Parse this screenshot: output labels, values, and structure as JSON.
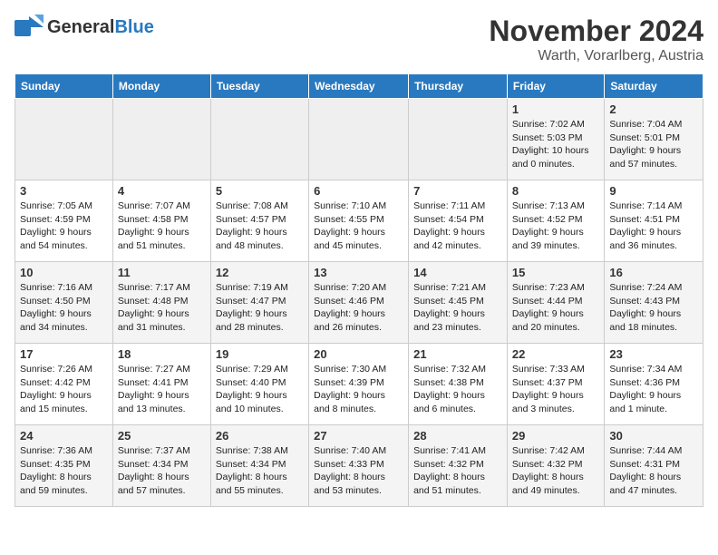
{
  "header": {
    "logo_general": "General",
    "logo_blue": "Blue",
    "month": "November 2024",
    "location": "Warth, Vorarlberg, Austria"
  },
  "weekdays": [
    "Sunday",
    "Monday",
    "Tuesday",
    "Wednesday",
    "Thursday",
    "Friday",
    "Saturday"
  ],
  "weeks": [
    [
      {
        "day": "",
        "info": ""
      },
      {
        "day": "",
        "info": ""
      },
      {
        "day": "",
        "info": ""
      },
      {
        "day": "",
        "info": ""
      },
      {
        "day": "",
        "info": ""
      },
      {
        "day": "1",
        "info": "Sunrise: 7:02 AM\nSunset: 5:03 PM\nDaylight: 10 hours\nand 0 minutes."
      },
      {
        "day": "2",
        "info": "Sunrise: 7:04 AM\nSunset: 5:01 PM\nDaylight: 9 hours\nand 57 minutes."
      }
    ],
    [
      {
        "day": "3",
        "info": "Sunrise: 7:05 AM\nSunset: 4:59 PM\nDaylight: 9 hours\nand 54 minutes."
      },
      {
        "day": "4",
        "info": "Sunrise: 7:07 AM\nSunset: 4:58 PM\nDaylight: 9 hours\nand 51 minutes."
      },
      {
        "day": "5",
        "info": "Sunrise: 7:08 AM\nSunset: 4:57 PM\nDaylight: 9 hours\nand 48 minutes."
      },
      {
        "day": "6",
        "info": "Sunrise: 7:10 AM\nSunset: 4:55 PM\nDaylight: 9 hours\nand 45 minutes."
      },
      {
        "day": "7",
        "info": "Sunrise: 7:11 AM\nSunset: 4:54 PM\nDaylight: 9 hours\nand 42 minutes."
      },
      {
        "day": "8",
        "info": "Sunrise: 7:13 AM\nSunset: 4:52 PM\nDaylight: 9 hours\nand 39 minutes."
      },
      {
        "day": "9",
        "info": "Sunrise: 7:14 AM\nSunset: 4:51 PM\nDaylight: 9 hours\nand 36 minutes."
      }
    ],
    [
      {
        "day": "10",
        "info": "Sunrise: 7:16 AM\nSunset: 4:50 PM\nDaylight: 9 hours\nand 34 minutes."
      },
      {
        "day": "11",
        "info": "Sunrise: 7:17 AM\nSunset: 4:48 PM\nDaylight: 9 hours\nand 31 minutes."
      },
      {
        "day": "12",
        "info": "Sunrise: 7:19 AM\nSunset: 4:47 PM\nDaylight: 9 hours\nand 28 minutes."
      },
      {
        "day": "13",
        "info": "Sunrise: 7:20 AM\nSunset: 4:46 PM\nDaylight: 9 hours\nand 26 minutes."
      },
      {
        "day": "14",
        "info": "Sunrise: 7:21 AM\nSunset: 4:45 PM\nDaylight: 9 hours\nand 23 minutes."
      },
      {
        "day": "15",
        "info": "Sunrise: 7:23 AM\nSunset: 4:44 PM\nDaylight: 9 hours\nand 20 minutes."
      },
      {
        "day": "16",
        "info": "Sunrise: 7:24 AM\nSunset: 4:43 PM\nDaylight: 9 hours\nand 18 minutes."
      }
    ],
    [
      {
        "day": "17",
        "info": "Sunrise: 7:26 AM\nSunset: 4:42 PM\nDaylight: 9 hours\nand 15 minutes."
      },
      {
        "day": "18",
        "info": "Sunrise: 7:27 AM\nSunset: 4:41 PM\nDaylight: 9 hours\nand 13 minutes."
      },
      {
        "day": "19",
        "info": "Sunrise: 7:29 AM\nSunset: 4:40 PM\nDaylight: 9 hours\nand 10 minutes."
      },
      {
        "day": "20",
        "info": "Sunrise: 7:30 AM\nSunset: 4:39 PM\nDaylight: 9 hours\nand 8 minutes."
      },
      {
        "day": "21",
        "info": "Sunrise: 7:32 AM\nSunset: 4:38 PM\nDaylight: 9 hours\nand 6 minutes."
      },
      {
        "day": "22",
        "info": "Sunrise: 7:33 AM\nSunset: 4:37 PM\nDaylight: 9 hours\nand 3 minutes."
      },
      {
        "day": "23",
        "info": "Sunrise: 7:34 AM\nSunset: 4:36 PM\nDaylight: 9 hours\nand 1 minute."
      }
    ],
    [
      {
        "day": "24",
        "info": "Sunrise: 7:36 AM\nSunset: 4:35 PM\nDaylight: 8 hours\nand 59 minutes."
      },
      {
        "day": "25",
        "info": "Sunrise: 7:37 AM\nSunset: 4:34 PM\nDaylight: 8 hours\nand 57 minutes."
      },
      {
        "day": "26",
        "info": "Sunrise: 7:38 AM\nSunset: 4:34 PM\nDaylight: 8 hours\nand 55 minutes."
      },
      {
        "day": "27",
        "info": "Sunrise: 7:40 AM\nSunset: 4:33 PM\nDaylight: 8 hours\nand 53 minutes."
      },
      {
        "day": "28",
        "info": "Sunrise: 7:41 AM\nSunset: 4:32 PM\nDaylight: 8 hours\nand 51 minutes."
      },
      {
        "day": "29",
        "info": "Sunrise: 7:42 AM\nSunset: 4:32 PM\nDaylight: 8 hours\nand 49 minutes."
      },
      {
        "day": "30",
        "info": "Sunrise: 7:44 AM\nSunset: 4:31 PM\nDaylight: 8 hours\nand 47 minutes."
      }
    ]
  ]
}
